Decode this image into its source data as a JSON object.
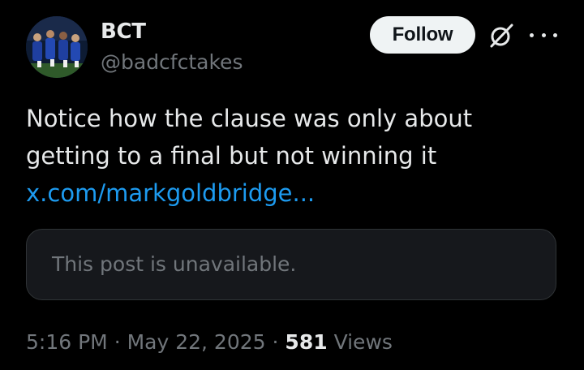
{
  "author": {
    "name": "BCT",
    "handle": "@badcfctakes",
    "avatar_icon": "team-photo-avatar"
  },
  "header": {
    "follow_label": "Follow",
    "grok_icon": "grok-icon",
    "more_icon": "more-options-icon"
  },
  "tweet": {
    "line1": "Notice how the clause was only about",
    "line2": "getting to a final but not winning it",
    "link_text": "x.com/markgoldbridge..."
  },
  "quote": {
    "text": "This post is unavailable."
  },
  "meta": {
    "time": "5:16 PM",
    "separator": "·",
    "date": "May 22, 2025",
    "views_count": "581",
    "views_label": "Views"
  },
  "colors": {
    "background": "#000000",
    "text": "#e7e9ea",
    "muted": "#71767b",
    "link": "#1d9bf0",
    "follow_bg": "#eff3f4"
  }
}
